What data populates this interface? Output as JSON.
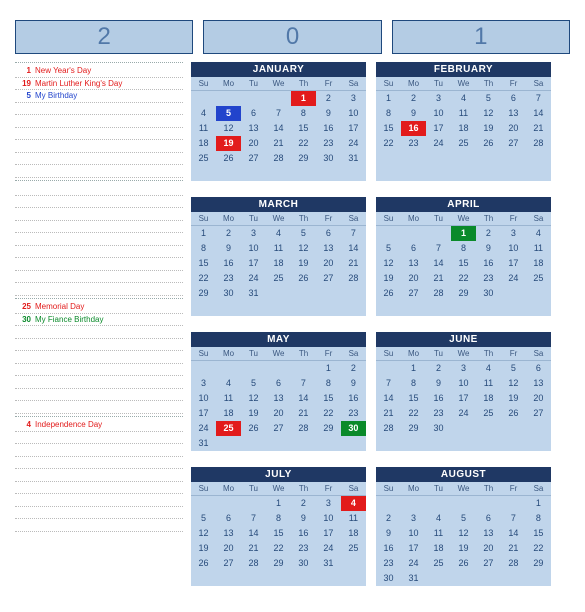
{
  "year_digits": [
    "2",
    "0",
    "1"
  ],
  "weekdays": [
    "Su",
    "Mo",
    "Tu",
    "We",
    "Th",
    "Fr",
    "Sa"
  ],
  "event_sections": [
    {
      "lines": 9,
      "events": [
        {
          "day": "1",
          "label": "New Year's Day",
          "color": "red"
        },
        {
          "day": "19",
          "label": "Martin Luther King's Day",
          "color": "red"
        },
        {
          "day": "5",
          "label": "My Birthday",
          "color": "blue"
        }
      ]
    },
    {
      "lines": 9,
      "events": []
    },
    {
      "lines": 9,
      "events": [
        {
          "day": "25",
          "label": "Memorial Day",
          "color": "red"
        },
        {
          "day": "30",
          "label": "My Fiance Birthday",
          "color": "green"
        }
      ]
    },
    {
      "lines": 9,
      "events": [
        {
          "day": "4",
          "label": "Independence Day",
          "color": "red"
        }
      ]
    }
  ],
  "months": [
    {
      "name": "JANUARY",
      "offset": 4,
      "ndays": 31,
      "highlights": [
        {
          "d": 1,
          "c": "red"
        },
        {
          "d": 5,
          "c": "blue"
        },
        {
          "d": 19,
          "c": "red"
        }
      ]
    },
    {
      "name": "FEBRUARY",
      "offset": 0,
      "ndays": 28,
      "highlights": [
        {
          "d": 16,
          "c": "red"
        }
      ]
    },
    {
      "name": "MARCH",
      "offset": 0,
      "ndays": 31,
      "highlights": []
    },
    {
      "name": "APRIL",
      "offset": 3,
      "ndays": 30,
      "highlights": [
        {
          "d": 1,
          "c": "green"
        }
      ]
    },
    {
      "name": "MAY",
      "offset": 5,
      "ndays": 31,
      "highlights": [
        {
          "d": 25,
          "c": "red"
        },
        {
          "d": 30,
          "c": "green"
        }
      ]
    },
    {
      "name": "JUNE",
      "offset": 1,
      "ndays": 30,
      "highlights": []
    },
    {
      "name": "JULY",
      "offset": 3,
      "ndays": 31,
      "highlights": [
        {
          "d": 4,
          "c": "red"
        }
      ]
    },
    {
      "name": "AUGUST",
      "offset": 6,
      "ndays": 31,
      "highlights": []
    }
  ]
}
